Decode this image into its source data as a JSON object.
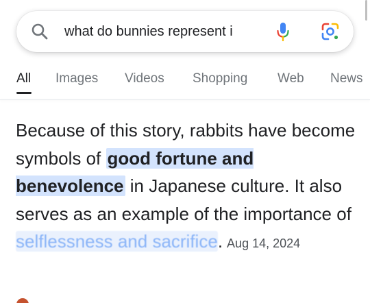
{
  "search": {
    "query": "what do bunnies represent i",
    "placeholder": ""
  },
  "tabs": [
    {
      "label": "All",
      "active": true
    },
    {
      "label": "Images",
      "active": false
    },
    {
      "label": "Videos",
      "active": false
    },
    {
      "label": "Shopping",
      "active": false
    },
    {
      "label": "Web",
      "active": false
    },
    {
      "label": "News",
      "active": false
    }
  ],
  "snippet": {
    "part1": "Because of this story, rabbits have become symbols of ",
    "highlight": "good fortune and benevolence",
    "part2": " in Japanese culture. It also serves as an example of the importance of ",
    "faded": "selflessness and sacrifice",
    "end": ".",
    "date": "Aug 14, 2024"
  },
  "icons": {
    "search": "search-icon",
    "mic": "microphone-icon",
    "lens": "google-lens-icon"
  },
  "colors": {
    "highlight_bg": "#d3e3fd",
    "faded_text": "#8ab4f8",
    "google_blue": "#4285F4",
    "google_red": "#EA4335",
    "google_yellow": "#FBBC04",
    "google_green": "#34A853"
  }
}
